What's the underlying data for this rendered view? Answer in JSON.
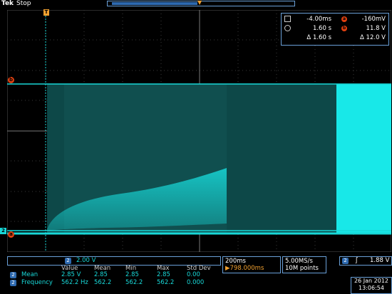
{
  "header": {
    "brand": "Tek",
    "state": "Stop"
  },
  "markers": {
    "trigger_pos": "T",
    "ref_b": "b",
    "ref_a": "a",
    "channel": "2"
  },
  "cursor_readout": {
    "row1": {
      "t_val": "-4.00ms",
      "v_label": "a",
      "v_val": "-160mV"
    },
    "row2": {
      "t_val": "1.60 s",
      "v_label": "b",
      "v_val": "11.8 V"
    },
    "row3": {
      "dt": "Δ 1.60 s",
      "dv": "Δ 12.0 V"
    }
  },
  "channel_scale": {
    "channel": "2",
    "volts_div": "2.00 V"
  },
  "measurements": {
    "headers": [
      "Value",
      "Mean",
      "Min",
      "Max",
      "Std Dev"
    ],
    "rows": [
      {
        "channel": "2",
        "name": "Mean",
        "value": "2.85 V",
        "mean": "2.85",
        "min": "2.85",
        "max": "2.85",
        "std": "0.00"
      },
      {
        "channel": "2",
        "name": "Frequency",
        "value": "562.2 Hz",
        "mean": "562.2",
        "min": "562.2",
        "max": "562.2",
        "std": "0.000"
      }
    ]
  },
  "timebase": {
    "time_div": "200ms",
    "position": "▶798.000ms"
  },
  "acquisition": {
    "rate": "5.00MS/s",
    "points": "10M points"
  },
  "trigger": {
    "channel": "2",
    "slope": "ʃ",
    "level": "1.88 V"
  },
  "datetime": {
    "date": "26 Jan  2012",
    "time": "13:06:54"
  },
  "colors": {
    "trace": "#18d8d8",
    "reference": "#e04010",
    "frame": "#6aa0d8"
  }
}
